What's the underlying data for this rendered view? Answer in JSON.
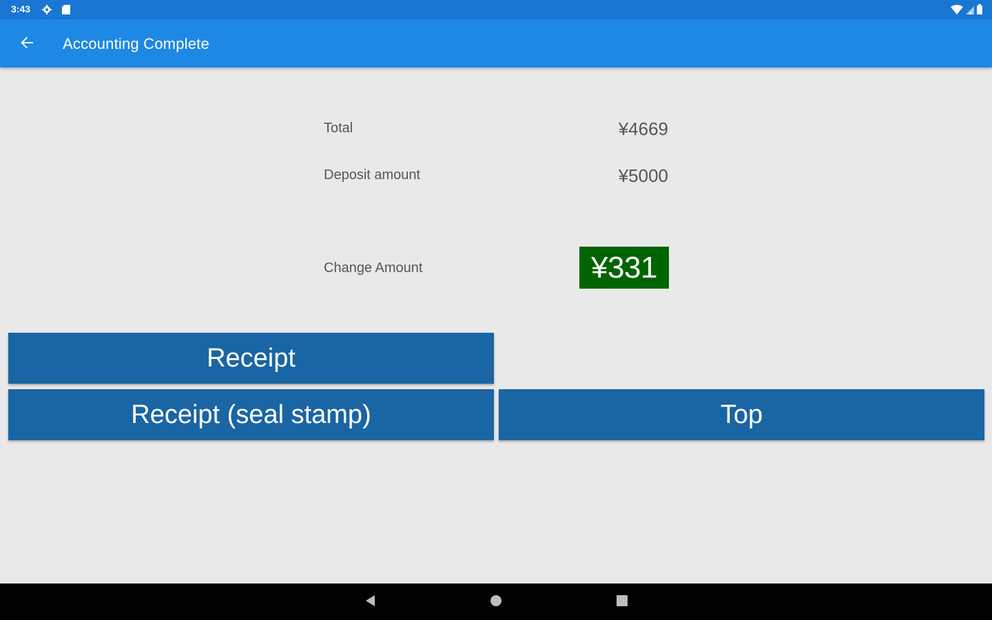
{
  "status_bar": {
    "time": "3:43",
    "icons": [
      "gear-icon",
      "sd-card-icon",
      "wifi-icon",
      "signal-icon",
      "battery-icon"
    ]
  },
  "app_bar": {
    "title": "Accounting Complete",
    "back_icon": "arrow-back-icon"
  },
  "summary": {
    "total_label": "Total",
    "total_value": "¥4669",
    "deposit_label": "Deposit amount",
    "deposit_value": "¥5000",
    "change_label": "Change Amount",
    "change_value": "¥331"
  },
  "buttons": {
    "receipt": "Receipt",
    "receipt_seal": "Receipt (seal stamp)",
    "top": "Top"
  },
  "nav_bar": {
    "icons": [
      "back-triangle-icon",
      "home-circle-icon",
      "recents-square-icon"
    ]
  },
  "colors": {
    "status_bar": "#1976d2",
    "app_bar": "#1e88e5",
    "background": "#e9e9e9",
    "button": "#1a65a3",
    "change_box": "#006400",
    "nav_bar": "#000000"
  }
}
